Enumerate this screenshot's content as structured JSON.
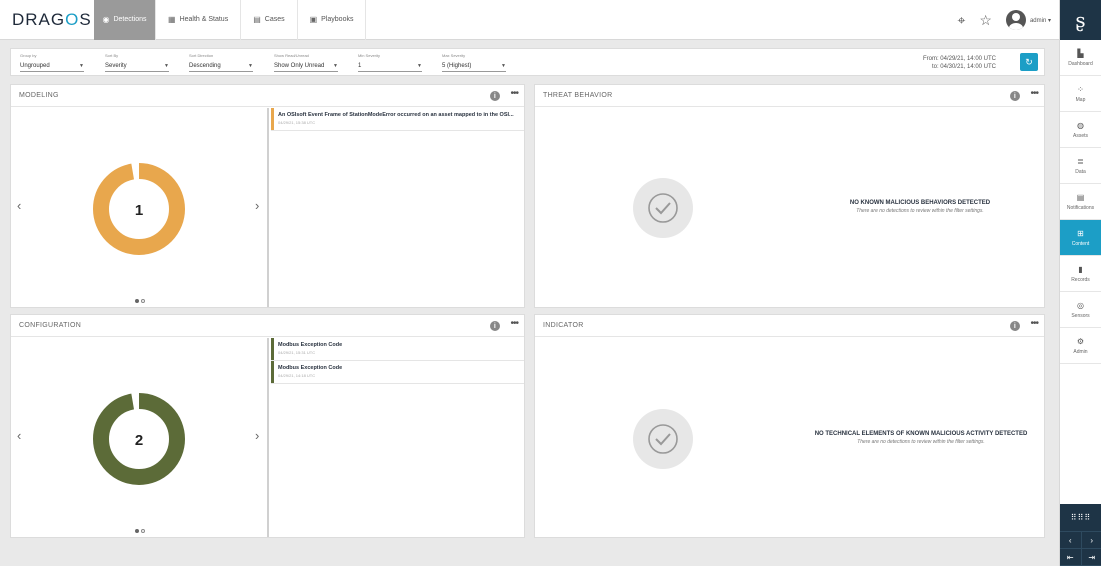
{
  "brand": {
    "logo_text": "DRAGOS"
  },
  "nav": {
    "tabs": [
      {
        "label": "Detections",
        "icon": "eye-icon"
      },
      {
        "label": "Health & Status",
        "icon": "grid-icon"
      },
      {
        "label": "Cases",
        "icon": "folder-icon"
      },
      {
        "label": "Playbooks",
        "icon": "book-icon"
      }
    ],
    "user": "admin"
  },
  "sidebar": {
    "items": [
      {
        "label": "Dashboard",
        "icon": "dashboard-icon"
      },
      {
        "label": "Map",
        "icon": "map-icon"
      },
      {
        "label": "Assets",
        "icon": "assets-icon"
      },
      {
        "label": "Data",
        "icon": "data-icon"
      },
      {
        "label": "Notifications",
        "icon": "notifications-icon"
      },
      {
        "label": "Content",
        "icon": "content-icon",
        "active": true
      },
      {
        "label": "Records",
        "icon": "records-icon"
      },
      {
        "label": "Sensors",
        "icon": "sensors-icon"
      },
      {
        "label": "Admin",
        "icon": "gear-icon"
      }
    ]
  },
  "filters": {
    "fields": [
      {
        "label": "Group by",
        "value": "Ungrouped"
      },
      {
        "label": "Sort By",
        "value": "Severity"
      },
      {
        "label": "Sort Direction",
        "value": "Descending"
      },
      {
        "label": "Show Read/Unread",
        "value": "Show Only Unread"
      },
      {
        "label": "Min Severity",
        "value": "1"
      },
      {
        "label": "Max Severity",
        "value": "5 (Highest)"
      }
    ],
    "from": "From: 04/29/21, 14:00 UTC",
    "to": "to: 04/30/21, 14:00 UTC"
  },
  "panels": {
    "modeling": {
      "title": "MODELING",
      "count": "1",
      "ring_color": "#e8a74d",
      "items": [
        {
          "title": "An OSIsoft Event Frame of StationModeError occurred on an asset mapped to in the OSI...",
          "date": "04/29/21, 15:38 UTC"
        }
      ]
    },
    "threat": {
      "title": "THREAT BEHAVIOR",
      "empty_title": "NO KNOWN MALICIOUS BEHAVIORS DETECTED",
      "empty_sub": "There are no detections to review within the filter settings."
    },
    "configuration": {
      "title": "CONFIGURATION",
      "count": "2",
      "ring_color": "#5c6b38",
      "items": [
        {
          "title": "Modbus Exception Code",
          "date": "04/29/21, 15:31 UTC"
        },
        {
          "title": "Modbus Exception Code",
          "date": "04/29/21, 14:18 UTC"
        }
      ]
    },
    "indicator": {
      "title": "INDICATOR",
      "empty_title": "NO TECHNICAL ELEMENTS OF KNOWN MALICIOUS ACTIVITY DETECTED",
      "empty_sub": "There are no detections to review within the filter settings."
    }
  }
}
